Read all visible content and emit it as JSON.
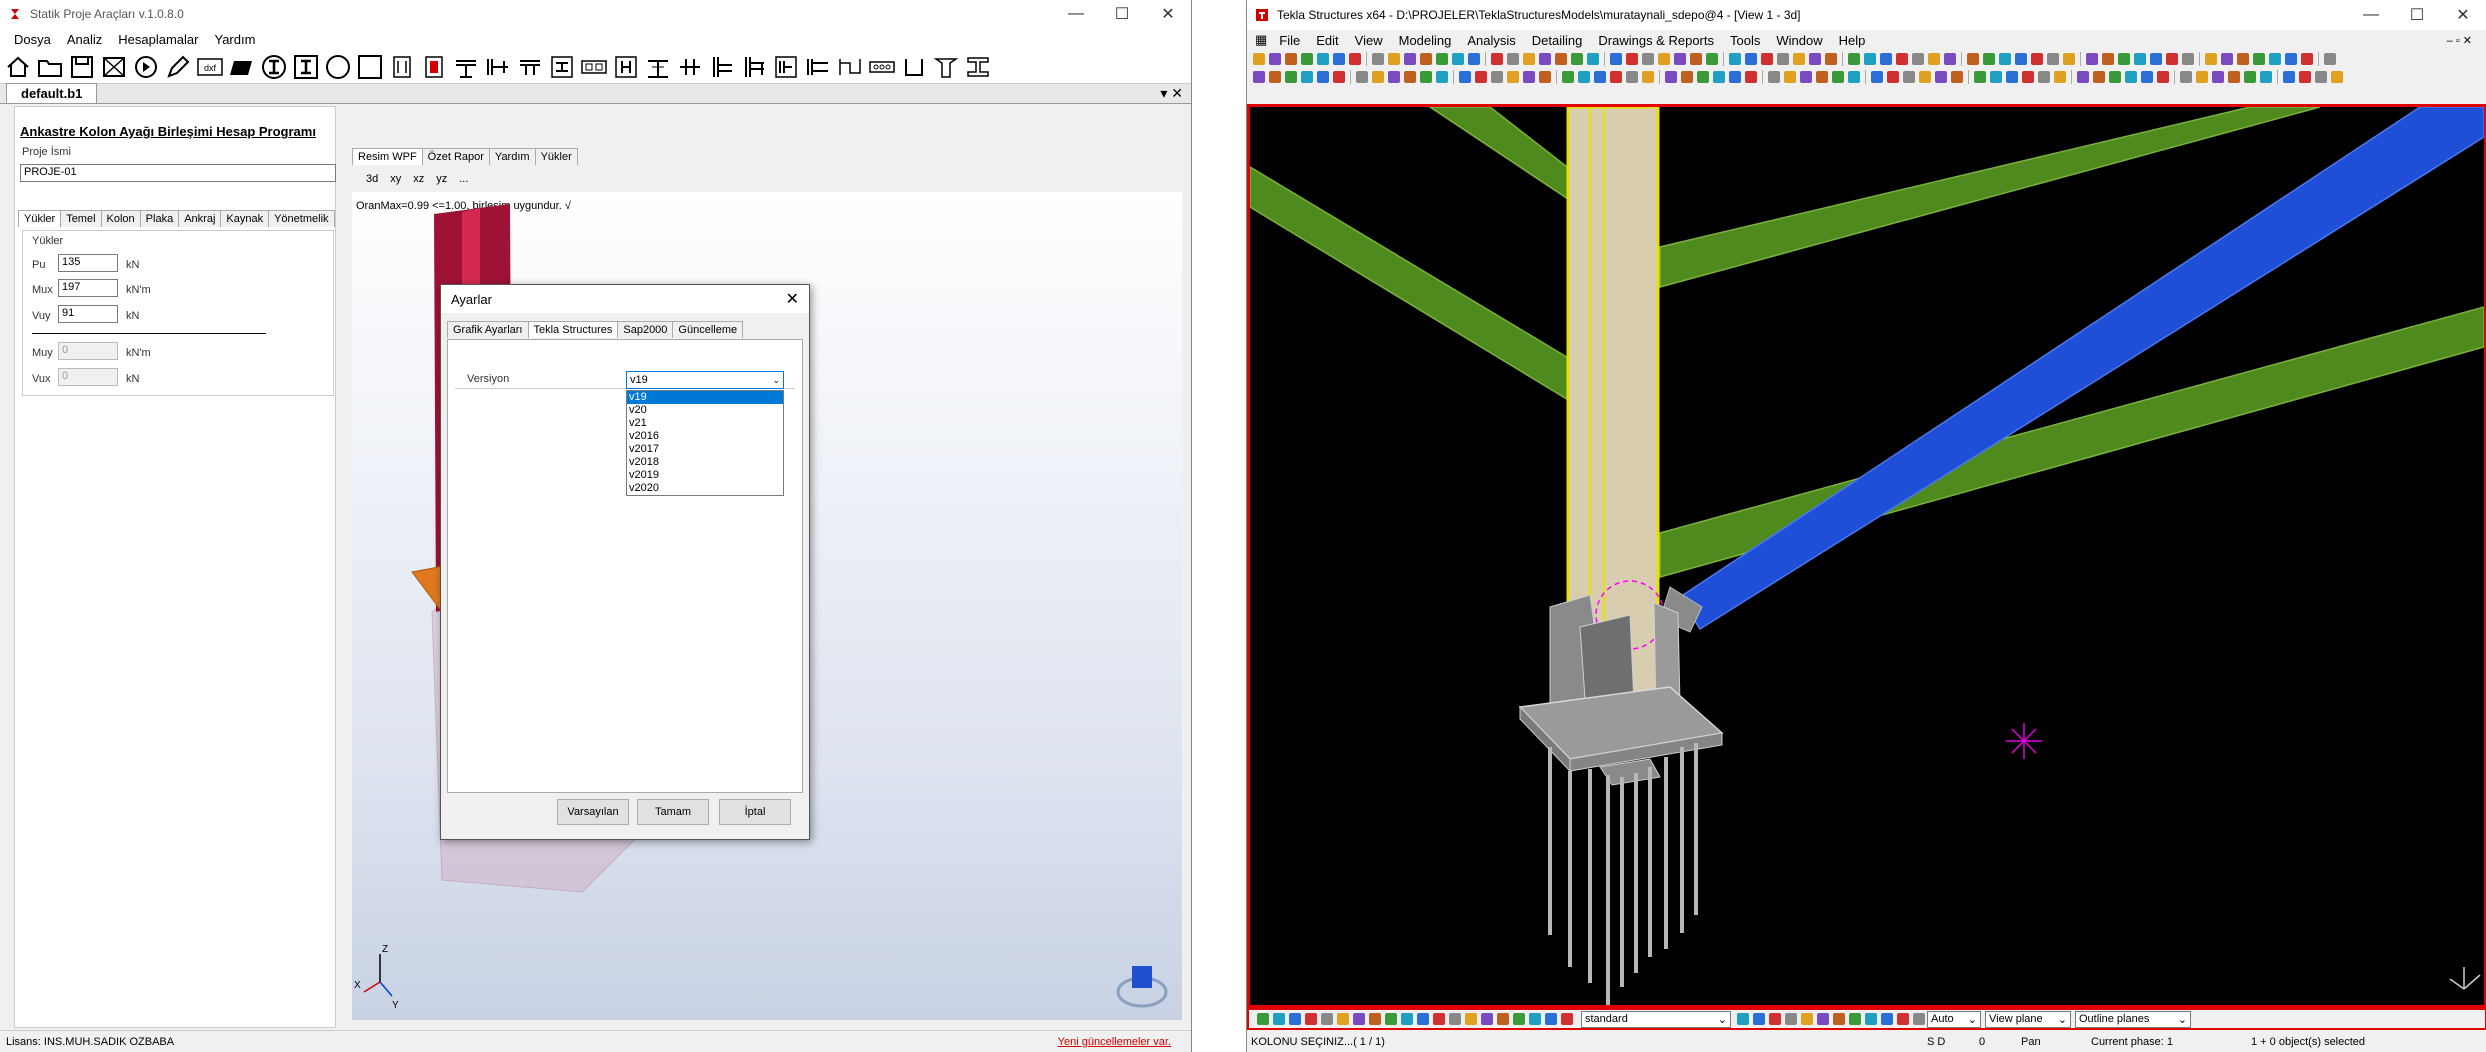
{
  "left_app": {
    "title": "Statik Proje Araçları v.1.0.8.0",
    "menu": [
      "Dosya",
      "Analiz",
      "Hesaplamalar",
      "Yardım"
    ],
    "toolbar_dxf": "dxf",
    "doc_tab": "default.b1",
    "form_title": "Ankastre Kolon Ayağı Birleşimi Hesap Programı",
    "project_name_label": "Proje İsmi",
    "project_name_value": "PROJE-01",
    "input_tabs": [
      "Yükler",
      "Temel",
      "Kolon",
      "Plaka",
      "Ankraj",
      "Kaynak",
      "Yönetmelik"
    ],
    "loads_group": "Yükler",
    "loads": [
      {
        "label": "Pu",
        "value": "135",
        "unit": "kN"
      },
      {
        "label": "Mux",
        "value": "197",
        "unit": "kN'm"
      },
      {
        "label": "Vuy",
        "value": "91",
        "unit": "kN"
      },
      {
        "label": "Muy",
        "value": "0",
        "unit": "kN'm"
      },
      {
        "label": "Vux",
        "value": "0",
        "unit": "kN"
      }
    ],
    "view_tabs": [
      "Resim WPF",
      "Özet Rapor",
      "Yardım",
      "Yükler"
    ],
    "view_buttons": [
      "3d",
      "xy",
      "xz",
      "yz",
      "..."
    ],
    "result_text": "OranMax=0.99 <=1.00, birleşim uygundur. √",
    "axis_labels": {
      "x": "X",
      "y": "Y",
      "z": "Z"
    },
    "status_license": "Lisans: INS.MUH.SADIK OZBABA",
    "status_update": "Yeni güncellemeler var.",
    "colors": {
      "column": "#b4163c",
      "plate": "#e07820",
      "bolt": "#3aa8a0",
      "link": "#d00000"
    }
  },
  "dialog": {
    "title": "Ayarlar",
    "tabs": [
      "Grafik Ayarları",
      "Tekla Structures",
      "Sap2000",
      "Güncelleme"
    ],
    "version_label": "Versiyon",
    "version_selected": "v19",
    "version_options": [
      "v19",
      "v20",
      "v21",
      "v2016",
      "v2017",
      "v2018",
      "v2019",
      "v2020"
    ],
    "buttons": {
      "default": "Varsayılan",
      "ok": "Tamam",
      "cancel": "İptal"
    }
  },
  "right_app": {
    "title": "Tekla Structures x64 - D:\\PROJELER\\TeklaStructuresModels\\murataynali_sdepo@4 - [View 1 - 3d]",
    "menu": [
      "File",
      "Edit",
      "View",
      "Modeling",
      "Analysis",
      "Detailing",
      "Drawings & Reports",
      "Tools",
      "Window",
      "Help"
    ],
    "bottom_combos": {
      "standard": "standard",
      "auto": "Auto",
      "view_plane": "View plane",
      "outline": "Outline planes"
    },
    "status": {
      "prompt": "KOLONU SEÇINIZ...( 1 / 1)",
      "sd": "S D",
      "zero": "0",
      "pan": "Pan",
      "phase": "Current phase: 1",
      "selected": "1 + 0 object(s) selected"
    },
    "colors": {
      "beam_green": "#4f8a1e",
      "brace_blue": "#1f4fd6",
      "column_fill": "#d9cdb0",
      "column_edge": "#e8e000",
      "base": "#9a9a9a",
      "star": "#e000e0"
    }
  }
}
